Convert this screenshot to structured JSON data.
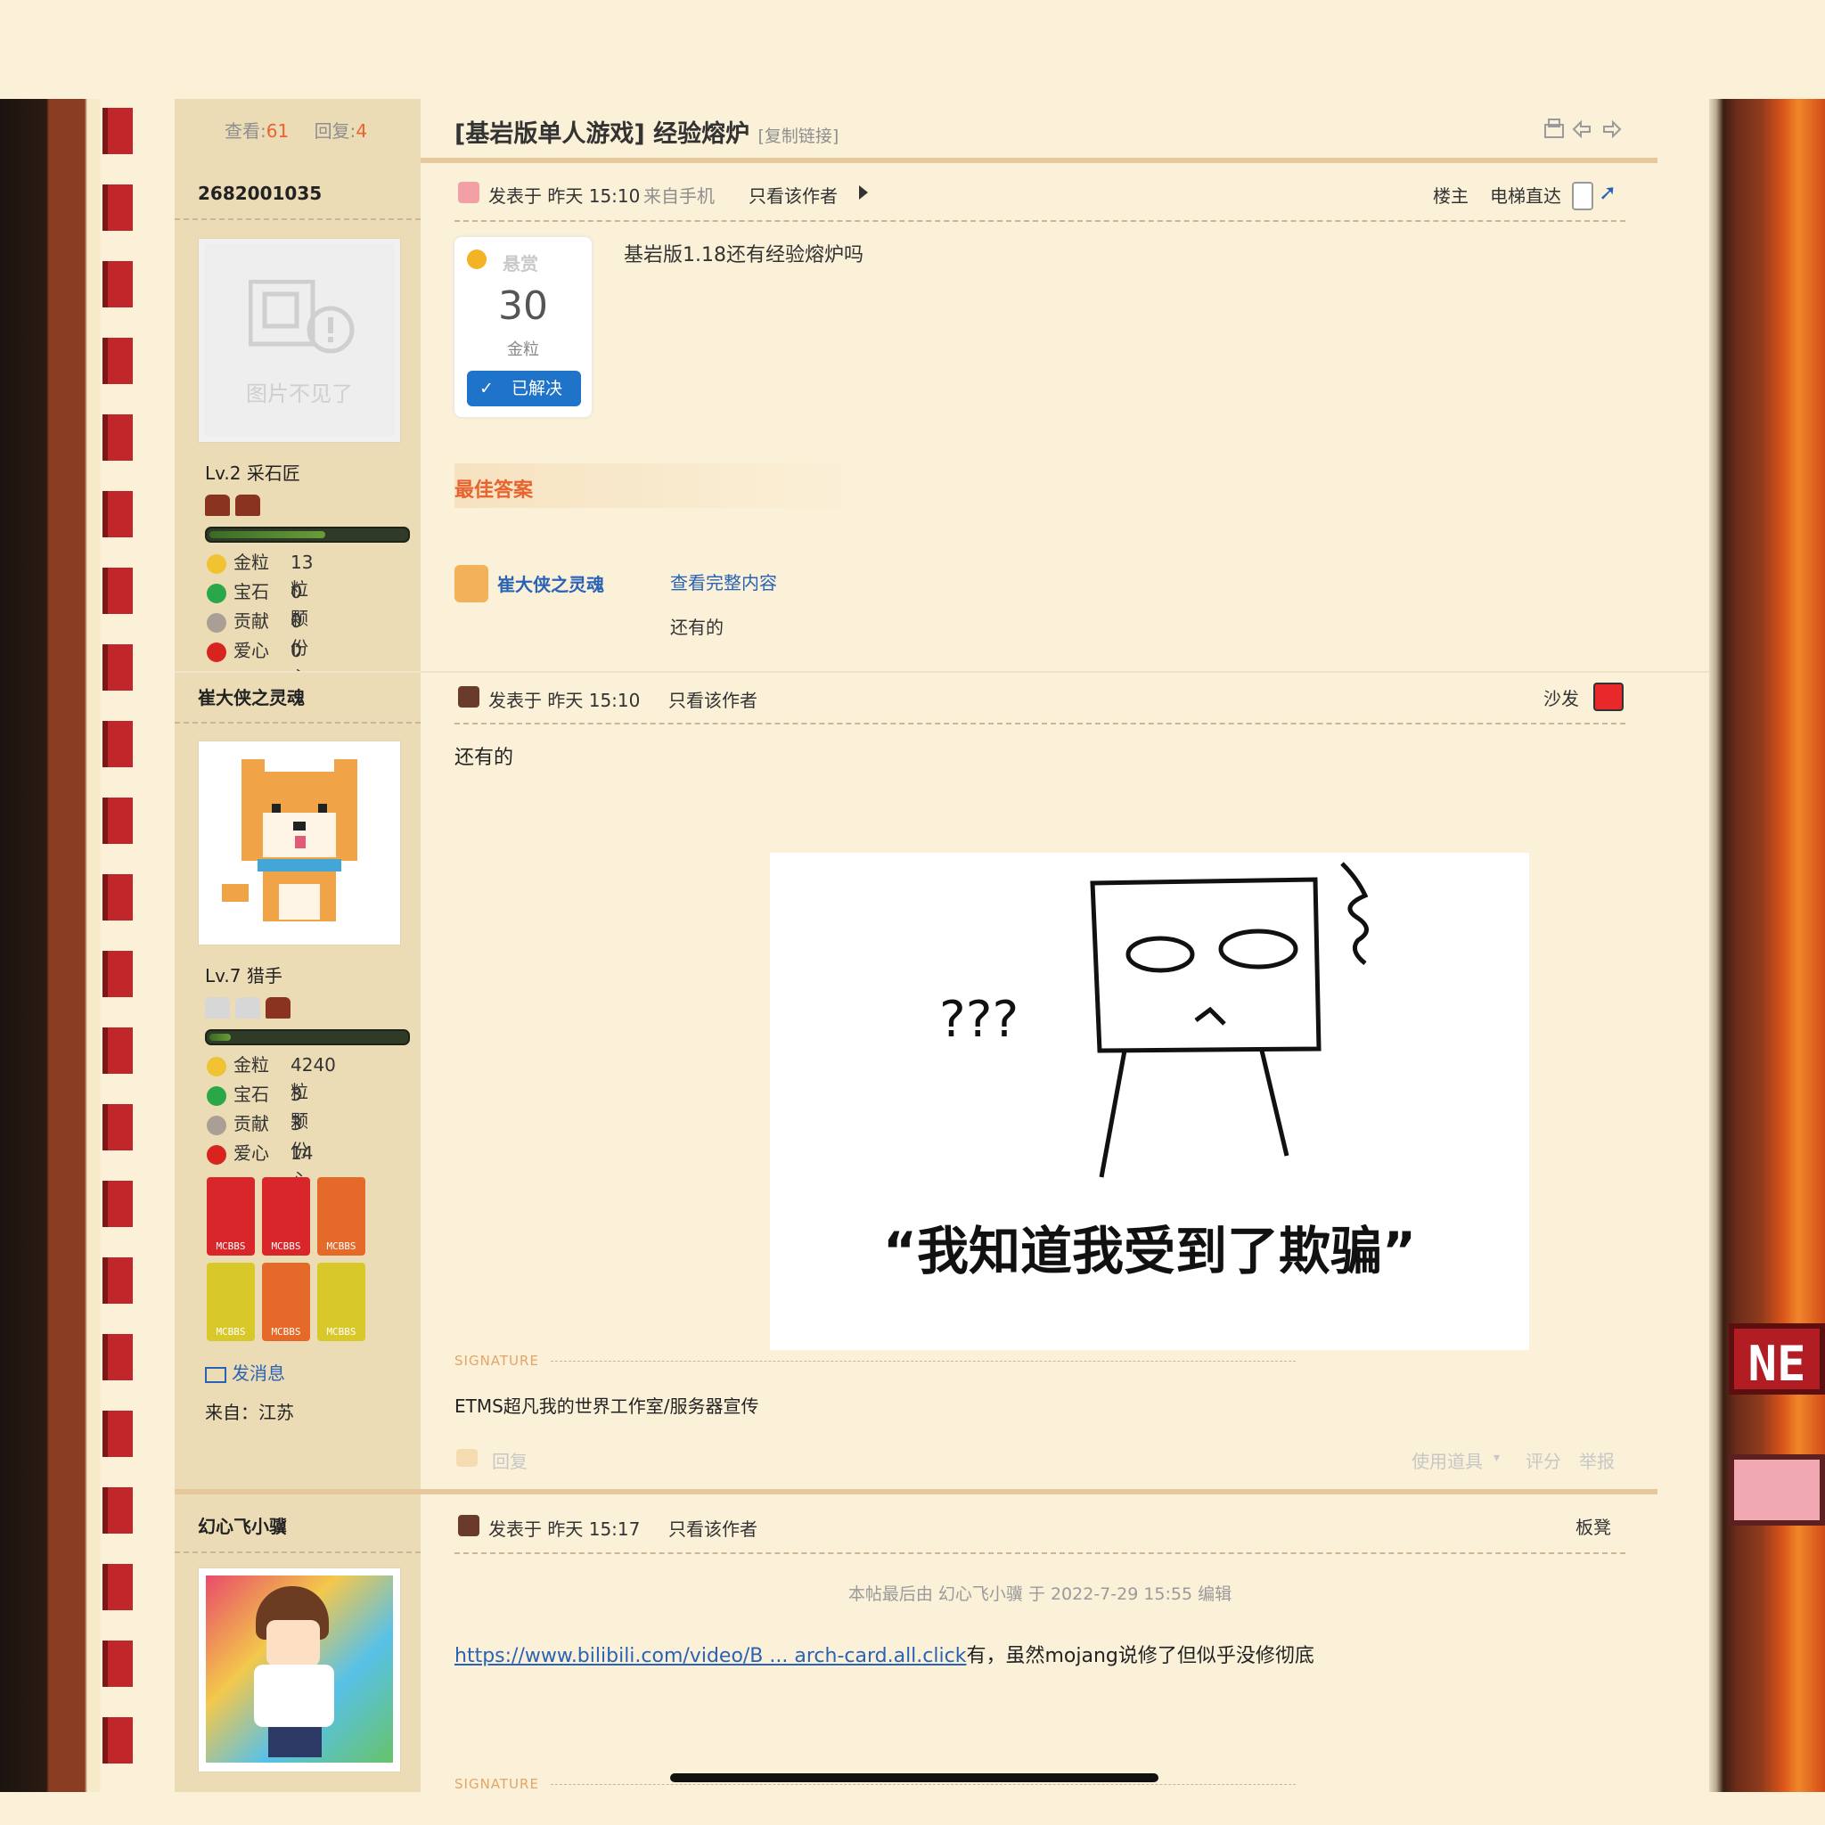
{
  "thread": {
    "views_label": "查看:",
    "views_value": "61",
    "replies_label": "回复:",
    "replies_value": "4",
    "title": "[基岩版单人游戏] 经验熔炉",
    "copy_link": "[复制链接]"
  },
  "post1": {
    "author": "2682001035",
    "avatar_missing_text": "图片不见了",
    "level": "Lv.2 采石匠",
    "stats": [
      {
        "label": "金粒",
        "value": "13 粒",
        "icon": "gold-nugget-icon"
      },
      {
        "label": "宝石",
        "value": "0 颗",
        "icon": "emerald-icon"
      },
      {
        "label": "贡献",
        "value": "0 份",
        "icon": "contribution-icon"
      },
      {
        "label": "爱心",
        "value": "0 心",
        "icon": "apple-icon"
      }
    ],
    "posted": "发表于 昨天 15:10",
    "from_mobile": "来自手机",
    "only_author": "只看该作者",
    "floor": "楼主",
    "elevator": "电梯直达",
    "bounty_label": "悬赏",
    "bounty_amount": "30",
    "bounty_unit": "金粒",
    "solved": "已解决",
    "content": "基岩版1.18还有经验熔炉吗",
    "best_answer_title": "最佳答案",
    "best_answer_user": "崔大侠之灵魂",
    "view_full": "查看完整内容",
    "best_answer_text": "还有的"
  },
  "post2": {
    "author": "崔大侠之灵魂",
    "level": "Lv.7 猎手",
    "stats": [
      {
        "label": "金粒",
        "value": "4240 粒",
        "icon": "gold-nugget-icon"
      },
      {
        "label": "宝石",
        "value": "3 颗",
        "icon": "emerald-icon"
      },
      {
        "label": "贡献",
        "value": "3 份",
        "icon": "contribution-icon"
      },
      {
        "label": "爱心",
        "value": "14 心",
        "icon": "apple-icon"
      }
    ],
    "badges": [
      "MCBBS",
      "MCBBS",
      "MCBBS",
      "MCBBS",
      "MCBBS",
      "MCBBS"
    ],
    "send_message": "发消息",
    "location": "来自：江苏",
    "posted": "发表于 昨天 15:10",
    "only_author": "只看该作者",
    "floor": "沙发",
    "content": "还有的",
    "meme_caption": "“我知道我受到了欺骗”",
    "meme_marks": "???",
    "signature_label": "SIGNATURE",
    "signature": "ETMS超凡我的世界工作室/服务器宣传",
    "reply": "回复",
    "use_item": "使用道具",
    "rate": "评分",
    "report": "举报"
  },
  "post3": {
    "author": "幻心飞小骥",
    "posted": "发表于 昨天 15:17",
    "only_author": "只看该作者",
    "floor": "板凳",
    "edit_note": "本帖最后由 幻心飞小骥 于 2022-7-29 15:55 编辑",
    "link_text": "https://www.bilibili.com/video/B ... arch-card.all.click",
    "content_after_link": "有，虽然mojang说修了但似乎没修彻底",
    "signature_label": "SIGNATURE"
  },
  "right_sign": "NE"
}
